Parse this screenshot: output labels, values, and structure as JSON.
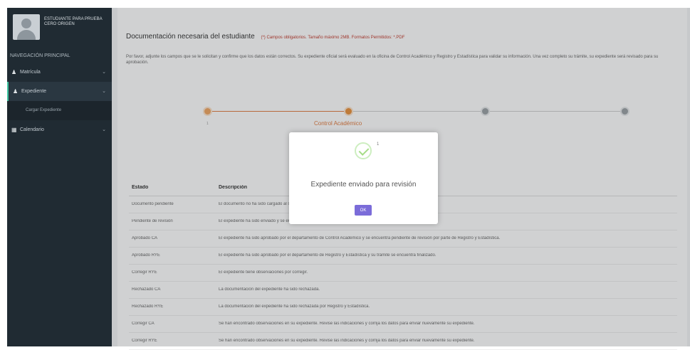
{
  "sidebar": {
    "profile_name": "ESTUDIANTE PARA PRUEBA CERO ORIGEN",
    "section_title": "NAVEGACIÓN PRINCIPAL",
    "items": [
      {
        "label": "Matrícula",
        "icon": "user-icon"
      },
      {
        "label": "Expediente",
        "icon": "user-icon"
      },
      {
        "label": "Calendario",
        "icon": "calendar-icon"
      }
    ],
    "submenu_label": "Cargar Expediente"
  },
  "main": {
    "heading": "Documentación necesaria del estudiante",
    "heading_note": "(*) Campos obligatorios. Tamaño máximo 2MB. Formatos Permitidos: *.PDF",
    "intro": "Por favor, adjunte los campos que se le solicitan y confirme que los datos están correctos. Su expediente oficial será evaluado en la oficina de Control Académico y Registro y Estadística para validar su información. Una vez completo su trámite, su expediente será revisado para su aprobación.",
    "stepper": {
      "current_label": "Control Académico",
      "first_num": "1"
    },
    "table": {
      "headers": [
        "Estado",
        "Descripción"
      ],
      "rows": [
        {
          "estado": "Documento pendiente",
          "desc": "El documento no ha sido cargado al sistema."
        },
        {
          "estado": "Pendiente de revisión",
          "desc": "El expediente ha sido enviado y se encuentra pendiente de revisión por parte de Control Académico."
        },
        {
          "estado": "Aprobado CA",
          "desc": "El expediente ha sido aprobado por el departamento de Control Académico y se encuentra pendiente de revisión por parte de Registro y Estadística."
        },
        {
          "estado": "Aprobado RYE",
          "desc": "El expediente ha sido aprobado por el departamento de Registro y Estadística y su trámite se encuentra finalizado."
        },
        {
          "estado": "Corregir RYE",
          "desc": "El expediente tiene observaciones por corregir."
        },
        {
          "estado": "Rechazado CA",
          "desc": "La documentación del expediente ha sido rechazada."
        },
        {
          "estado": "Rechazado RYE",
          "desc": "La documentación del expediente ha sido rechazada por Registro y Estadística."
        },
        {
          "estado": "Corregir CA",
          "desc": "Se han encontrado observaciones en su expediente. Revise las indicaciones y corrija los datos para enviar nuevamente su expediente."
        },
        {
          "estado": "Corregir RYE",
          "desc": "Se han encontrado observaciones en su expediente. Revise las indicaciones y corrija los datos para enviar nuevamente su expediente."
        }
      ]
    }
  },
  "modal": {
    "counter": "1",
    "message": "Expediente enviado para revisión",
    "ok_label": "OK",
    "icon": "check-icon"
  },
  "colors": {
    "sidebar_bg": "#202b33",
    "accent_orange": "#e07a3f",
    "note_red": "#c0392b",
    "ok_button": "#7b6cd9",
    "success_green": "#a5dc86",
    "active_marker": "#3ec4a0"
  }
}
